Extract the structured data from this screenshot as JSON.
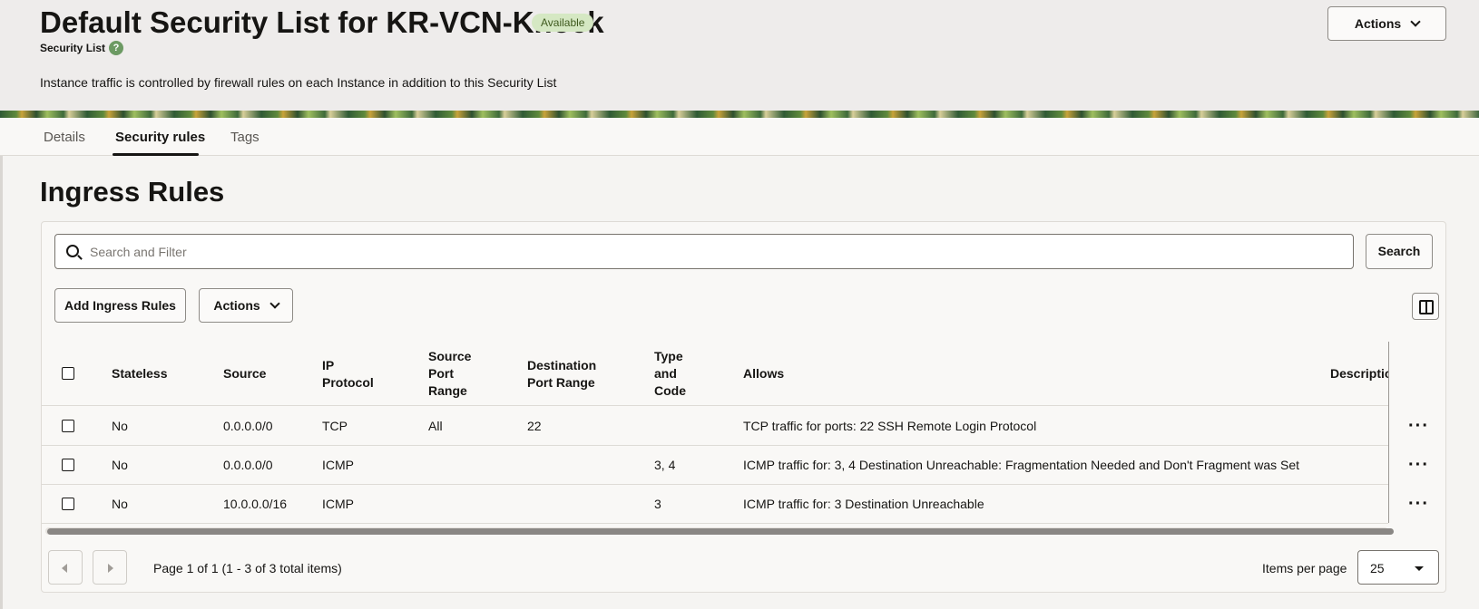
{
  "header": {
    "title": "Default Security List for KR-VCN-Knock",
    "status_badge": "Available",
    "subtitle": "Security List",
    "help_icon": "question-mark-icon",
    "info": "Instance traffic is controlled by firewall rules on each Instance in addition to this Security List",
    "actions_label": "Actions"
  },
  "tabs": [
    {
      "label": "Details",
      "active": false
    },
    {
      "label": "Security rules",
      "active": true
    },
    {
      "label": "Tags",
      "active": false
    }
  ],
  "ingress": {
    "title": "Ingress Rules",
    "search": {
      "placeholder": "Search and Filter",
      "button": "Search"
    },
    "add_button": "Add Ingress Rules",
    "actions_label": "Actions",
    "columns": {
      "stateless": "Stateless",
      "source": "Source",
      "ip_protocol": "IP Protocol",
      "source_port_range": "Source Port Range",
      "destination_port_range": "Destination Port Range",
      "type_and_code": "Type and Code",
      "allows": "Allows",
      "description": "Description"
    },
    "rows": [
      {
        "stateless": "No",
        "source": "0.0.0.0/0",
        "protocol": "TCP",
        "src_port": "All",
        "dst_port": "22",
        "type_code": "",
        "allows": "TCP traffic for ports: 22 SSH Remote Login Protocol"
      },
      {
        "stateless": "No",
        "source": "0.0.0.0/0",
        "protocol": "ICMP",
        "src_port": "",
        "dst_port": "",
        "type_code": "3, 4",
        "allows": "ICMP traffic for: 3, 4 Destination Unreachable: Fragmentation Needed and Don't Fragment was Set"
      },
      {
        "stateless": "No",
        "source": "10.0.0.0/16",
        "protocol": "ICMP",
        "src_port": "",
        "dst_port": "",
        "type_code": "3",
        "allows": "ICMP traffic for: 3 Destination Unreachable"
      }
    ],
    "pagination": {
      "summary": "Page 1 of 1 (1 - 3 of 3 total items)",
      "items_per_page_label": "Items per page",
      "items_per_page": "25"
    }
  },
  "colors": {
    "badge_bg": "#d5e8c3",
    "help_icon": "#6c9a63",
    "page_bg": "#f5f4f2"
  }
}
